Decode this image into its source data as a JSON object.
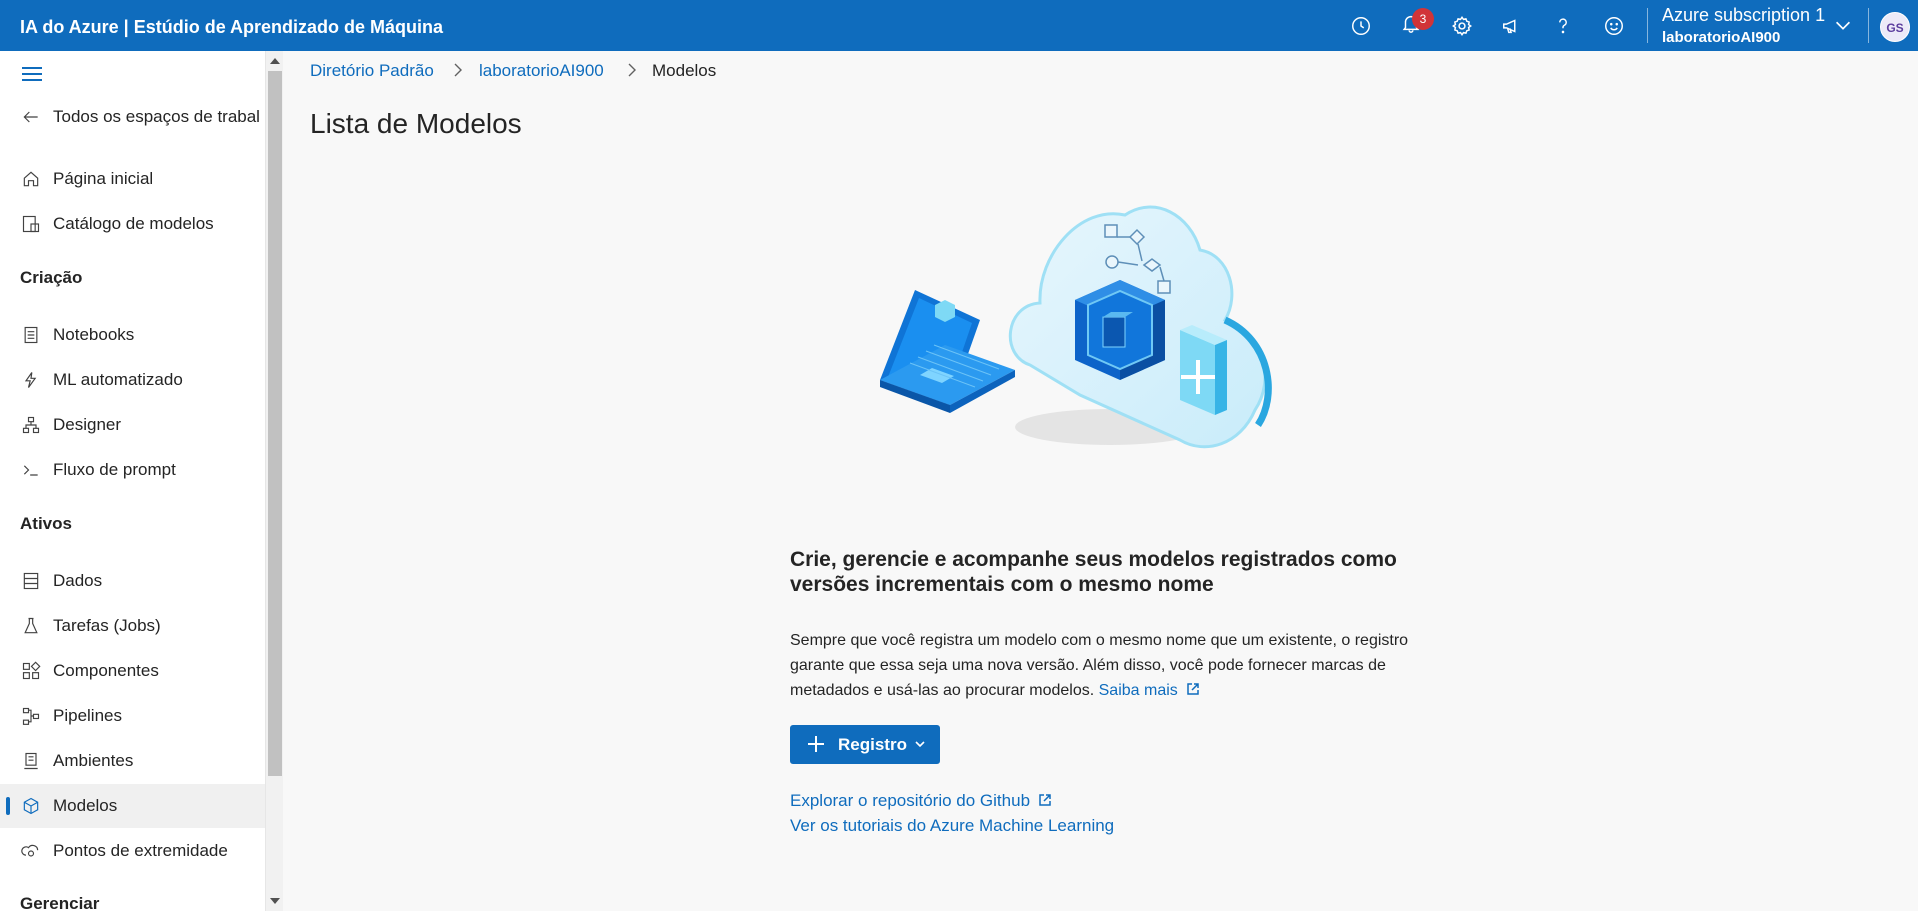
{
  "app": {
    "title": "IA do Azure | Estúdio de Aprendizado de Máquina"
  },
  "topbar": {
    "icons": [
      "history-icon",
      "bell-icon",
      "gear-icon",
      "megaphone-icon",
      "help-icon",
      "smiley-icon"
    ],
    "notification_count": "3",
    "subscription_name": "Azure subscription 1",
    "workspace_name": "laboratorioAI900",
    "avatar_initials": "GS"
  },
  "sidebar": {
    "back_label": "Todos os espaços de trabal",
    "items_top": [
      {
        "label": "Página inicial",
        "icon": "home-icon"
      },
      {
        "label": "Catálogo de modelos",
        "icon": "catalog-icon"
      }
    ],
    "section_creation": "Criação",
    "items_creation": [
      {
        "label": "Notebooks",
        "icon": "notebook-icon"
      },
      {
        "label": "ML automatizado",
        "icon": "automl-icon"
      },
      {
        "label": "Designer",
        "icon": "designer-icon"
      },
      {
        "label": "Fluxo de prompt",
        "icon": "prompt-icon"
      }
    ],
    "section_assets": "Ativos",
    "items_assets": [
      {
        "label": "Dados",
        "icon": "data-icon"
      },
      {
        "label": "Tarefas (Jobs)",
        "icon": "flask-icon"
      },
      {
        "label": "Componentes",
        "icon": "components-icon"
      },
      {
        "label": "Pipelines",
        "icon": "pipeline-icon"
      },
      {
        "label": "Ambientes",
        "icon": "environment-icon"
      },
      {
        "label": "Modelos",
        "icon": "cube-icon"
      },
      {
        "label": "Pontos de extremidade",
        "icon": "endpoint-icon"
      }
    ],
    "section_manage": "Gerenciar",
    "active_item": "Modelos"
  },
  "breadcrumb": {
    "items": [
      "Diretório Padrão",
      "laboratorioAI900"
    ],
    "current": "Modelos"
  },
  "main": {
    "title": "Lista de Modelos",
    "empty_heading": "Crie, gerencie e acompanhe seus modelos registrados como versões incrementais com o mesmo nome",
    "empty_body": "Sempre que você registra um modelo com o mesmo nome que um existente, o registro garante que essa seja uma nova versão. Além disso, você pode fornecer marcas de metadados e usá-las ao procurar modelos.",
    "learn_more": "Saiba mais",
    "register_button": "Registro",
    "github_link": "Explorar o repositório do Github",
    "tutorials_link": "Ver os tutoriais do Azure Machine Learning"
  },
  "colors": {
    "accent": "#0f6cbd",
    "badge": "#d13438"
  }
}
